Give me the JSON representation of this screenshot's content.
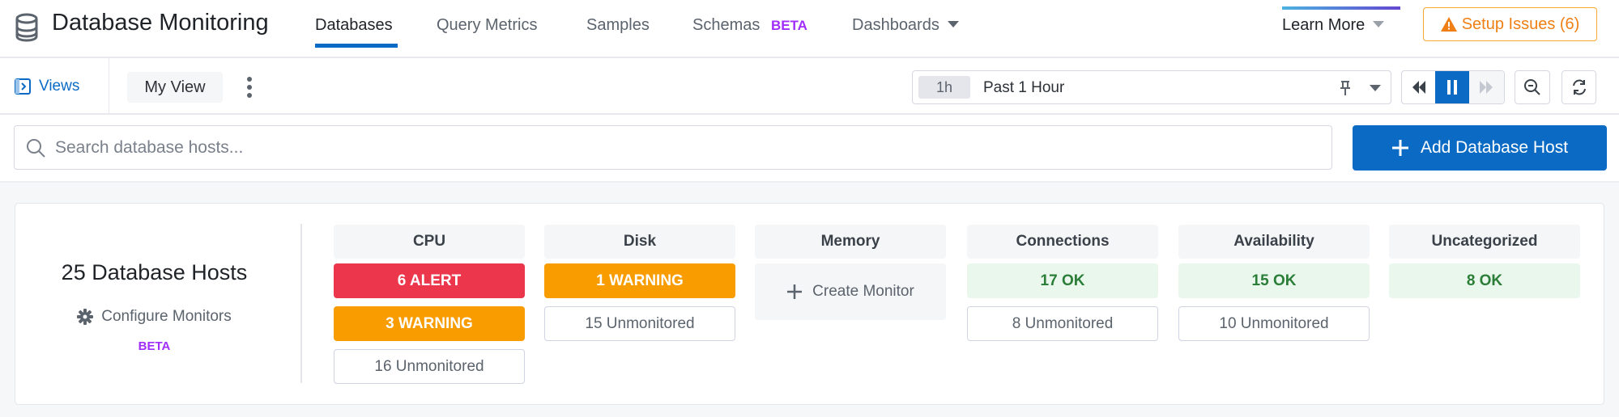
{
  "header": {
    "title": "Database Monitoring",
    "tabs": [
      {
        "label": "Databases",
        "active": true
      },
      {
        "label": "Query Metrics"
      },
      {
        "label": "Samples"
      },
      {
        "label": "Schemas",
        "badge": "BETA"
      },
      {
        "label": "Dashboards"
      }
    ],
    "learn_more": "Learn More",
    "setup_issues": "Setup Issues (6)"
  },
  "toolbar": {
    "views": "Views",
    "my_view": "My View",
    "time_chip": "1h",
    "time_label": "Past 1 Hour"
  },
  "search": {
    "placeholder": "Search database hosts...",
    "value": ""
  },
  "add_button": "Add Database Host",
  "summary": {
    "hosts": "25 Database Hosts",
    "configure": "Configure Monitors",
    "configure_badge": "BETA",
    "columns": [
      {
        "name": "CPU",
        "items": [
          {
            "text": "6 ALERT",
            "status": "alert"
          },
          {
            "text": "3 WARNING",
            "status": "warn"
          },
          {
            "text": "16 Unmonitored",
            "status": "unmon"
          }
        ]
      },
      {
        "name": "Disk",
        "items": [
          {
            "text": "1 WARNING",
            "status": "warn"
          },
          {
            "text": "15 Unmonitored",
            "status": "unmon"
          }
        ]
      },
      {
        "name": "Memory",
        "create": "Create Monitor"
      },
      {
        "name": "Connections",
        "items": [
          {
            "text": "17 OK",
            "status": "ok"
          },
          {
            "text": "8 Unmonitored",
            "status": "unmon"
          }
        ]
      },
      {
        "name": "Availability",
        "items": [
          {
            "text": "15 OK",
            "status": "ok"
          },
          {
            "text": "10 Unmonitored",
            "status": "unmon"
          }
        ]
      },
      {
        "name": "Uncategorized",
        "items": [
          {
            "text": "8 OK",
            "status": "ok"
          }
        ]
      }
    ]
  },
  "colors": {
    "accent": "#0b6bc4",
    "alert": "#eb364b",
    "warning": "#f89c00",
    "ok_bg": "#eaf7ec",
    "ok_text": "#2a7e38",
    "beta": "#a12dfa"
  }
}
